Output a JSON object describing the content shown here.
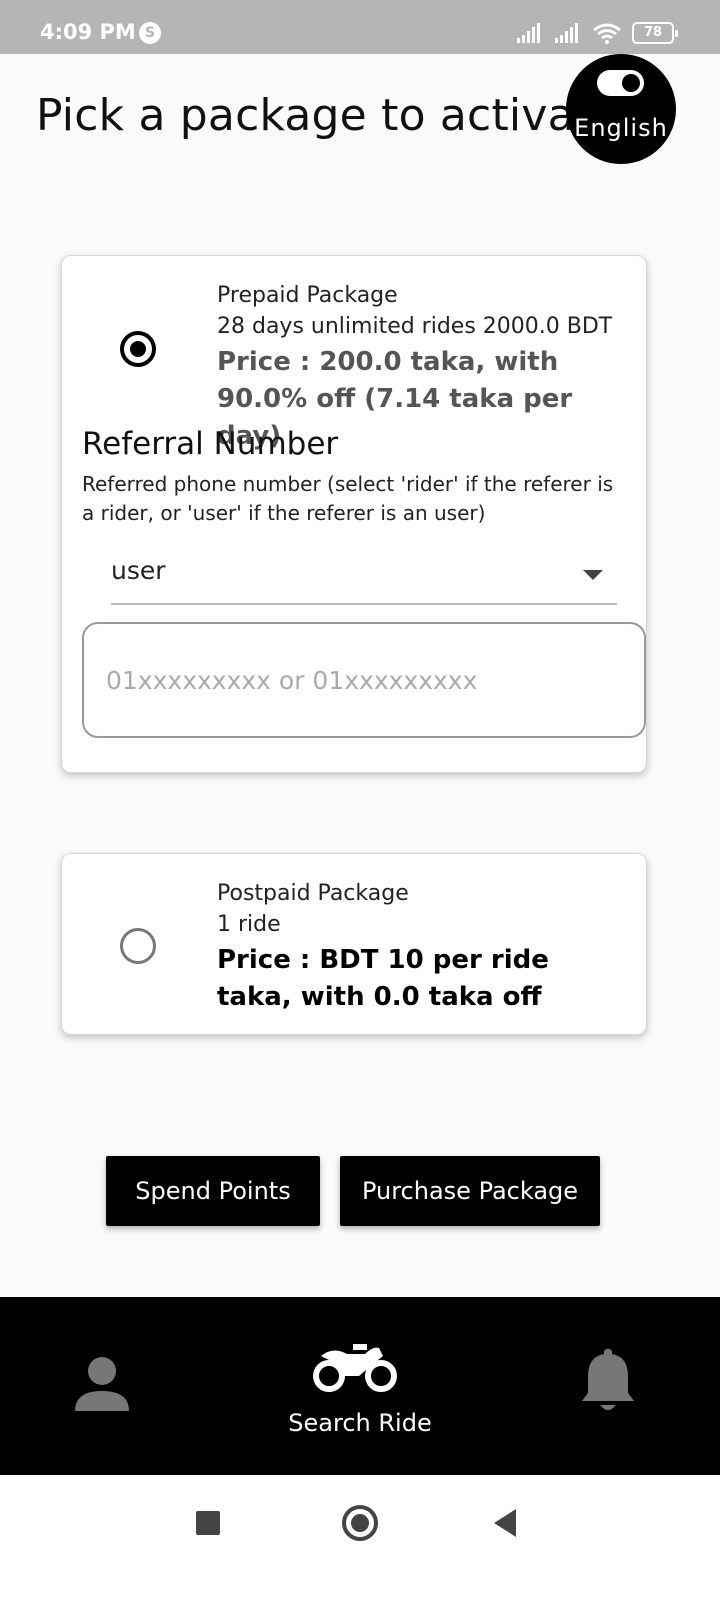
{
  "status_bar": {
    "time": "4:09 PM",
    "notification_icon": "S",
    "battery": "78",
    "icons": [
      "signal-icon",
      "signal-icon",
      "wifi-icon",
      "battery-icon"
    ]
  },
  "header": {
    "title": "Pick a package to activate",
    "language_label": "English"
  },
  "packages": [
    {
      "name": "Prepaid Package",
      "description": "28 days unlimited rides 2000.0 BDT",
      "price": "Price : 200.0 taka, with 90.0% off (7.14 taka per day)",
      "selected": true
    },
    {
      "name": "Postpaid Package",
      "description": "1 ride",
      "price": "Price : BDT 10 per ride taka, with 0.0 taka off",
      "selected": false
    }
  ],
  "referral": {
    "title": "Referral Number",
    "description": "Referred phone number (select 'rider' if the referer is a rider, or 'user' if the referer is an user)",
    "type_value": "user",
    "phone_value": "",
    "phone_placeholder": "01xxxxxxxxx or 01xxxxxxxxx"
  },
  "actions": {
    "spend_points": "Spend Points",
    "purchase_package": "Purchase Package"
  },
  "bottom_nav": {
    "search_ride_label": "Search Ride",
    "items": [
      "person-icon",
      "motorcycle-icon",
      "bell-icon"
    ]
  },
  "colors": {
    "primary": "#000000",
    "background": "#fafafa",
    "status_bar": "#b5b5b5",
    "inactive_icon": "#777777"
  }
}
